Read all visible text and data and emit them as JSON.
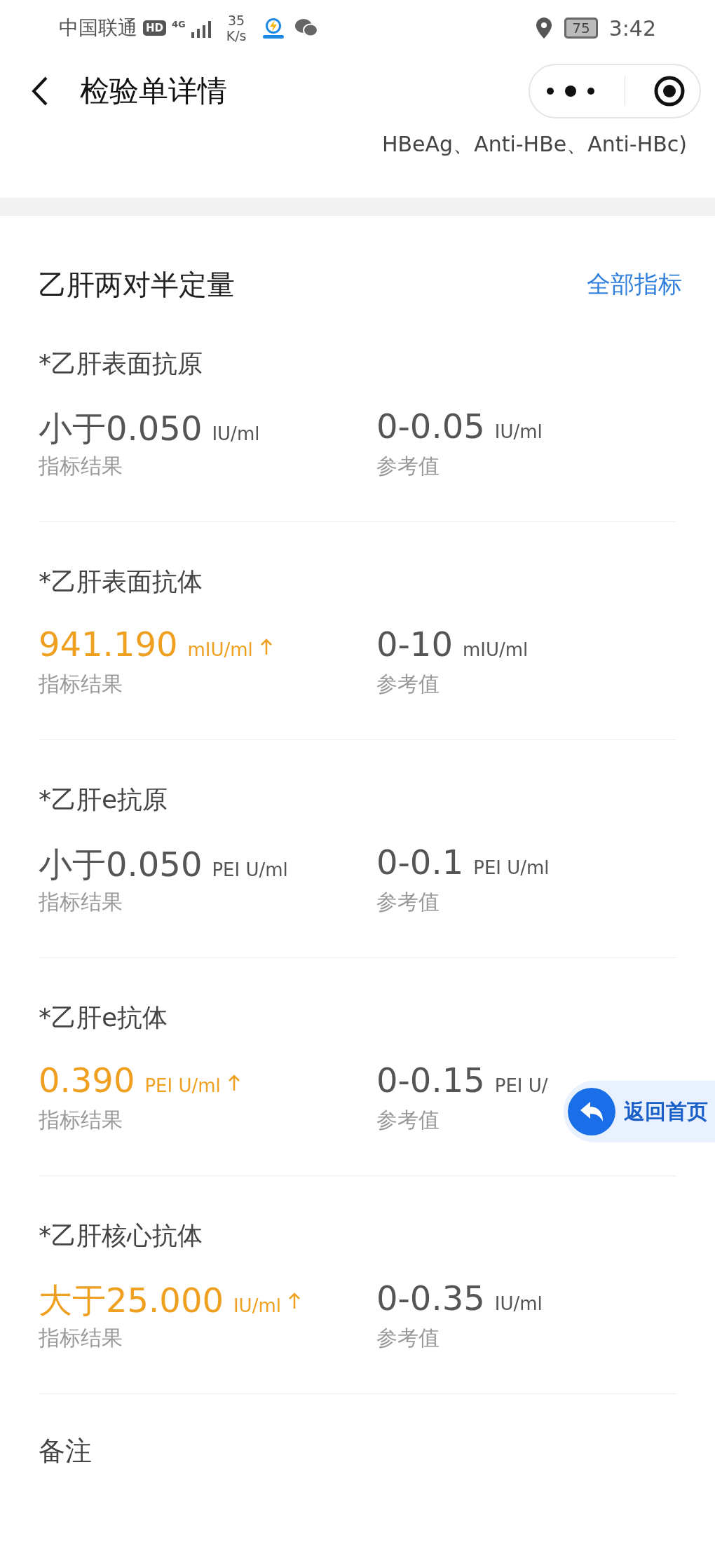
{
  "status_bar": {
    "carrier": "中国联通",
    "hd_badge": "HD",
    "network": "4G",
    "speed_value": "35",
    "speed_unit": "K/s",
    "battery": "75",
    "time": "3:42"
  },
  "header": {
    "title": "检验单详情"
  },
  "partial_text": "HBeAg、Anti-HBe、Anti-HBc)",
  "section": {
    "title": "乙肝两对半定量",
    "link": "全部指标",
    "items": [
      {
        "name": "*乙肝表面抗原",
        "value": "小于0.050",
        "unit": "IU/ml",
        "high": false,
        "value_label": "指标结果",
        "ref": "0-0.05",
        "ref_unit": "IU/ml",
        "ref_label": "参考值"
      },
      {
        "name": "*乙肝表面抗体",
        "value": "941.190",
        "unit": "mIU/ml",
        "high": true,
        "value_label": "指标结果",
        "ref": "0-10",
        "ref_unit": "mIU/ml",
        "ref_label": "参考值"
      },
      {
        "name": "*乙肝e抗原",
        "value": "小于0.050",
        "unit": "PEI U/ml",
        "high": false,
        "value_label": "指标结果",
        "ref": "0-0.1",
        "ref_unit": "PEI U/ml",
        "ref_label": "参考值"
      },
      {
        "name": "*乙肝e抗体",
        "value": "0.390",
        "unit": "PEI U/ml",
        "high": true,
        "value_label": "指标结果",
        "ref": "0-0.15",
        "ref_unit": "PEI U/",
        "ref_label": "参考值"
      },
      {
        "name": "*乙肝核心抗体",
        "value": "大于25.000",
        "unit": "IU/ml",
        "high": true,
        "value_label": "指标结果",
        "ref": "0-0.35",
        "ref_unit": "IU/ml",
        "ref_label": "参考值"
      }
    ]
  },
  "notes": {
    "title": "备注"
  },
  "float_button": {
    "label": "返回首页"
  }
}
